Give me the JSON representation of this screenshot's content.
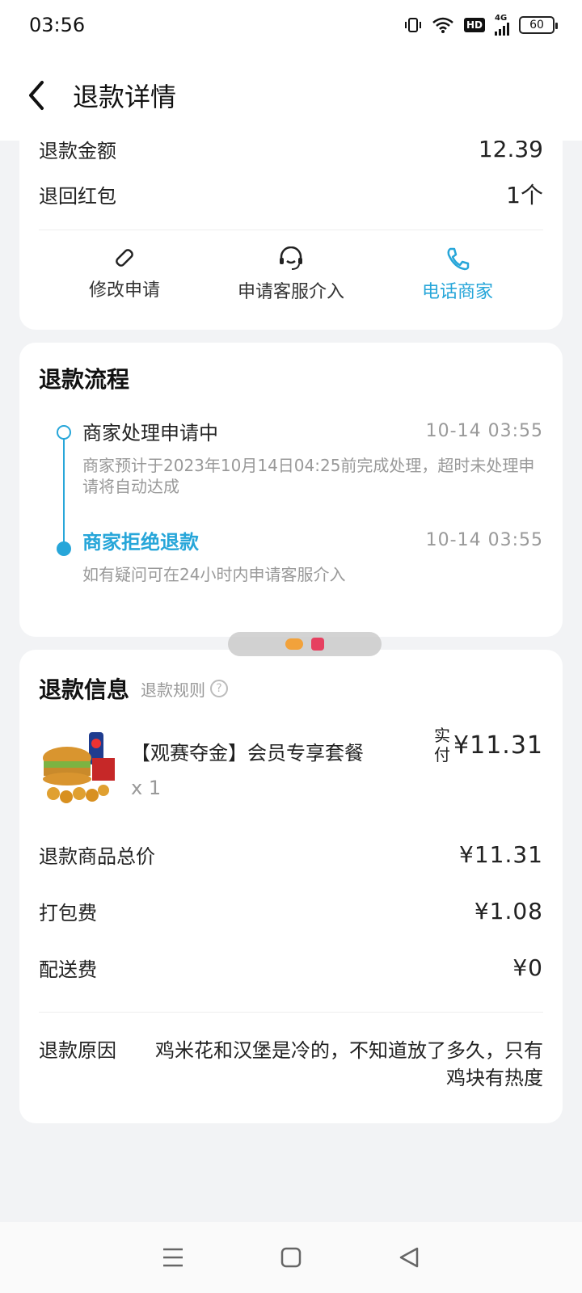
{
  "status_bar": {
    "time": "03:56",
    "network": "4G",
    "battery": "60",
    "hd_label": "HD"
  },
  "header": {
    "title": "退款详情"
  },
  "summary": {
    "partial_label": "退款金额",
    "partial_value": "12.39",
    "hongbao_label": "退回红包",
    "hongbao_value": "1个"
  },
  "actions": [
    {
      "label": "修改申请",
      "icon": "pencil-icon"
    },
    {
      "label": "申请客服介入",
      "icon": "headset-icon"
    },
    {
      "label": "电话商家",
      "icon": "phone-icon"
    }
  ],
  "process": {
    "title": "退款流程",
    "steps": [
      {
        "title": "商家处理申请中",
        "time": "10-14  03:55",
        "desc": "商家预计于2023年10月14日04:25前完成处理，超时未处理申请将自动达成"
      },
      {
        "title": "商家拒绝退款",
        "time": "10-14  03:55",
        "desc": "如有疑问可在24小时内申请客服介入"
      }
    ]
  },
  "refund_info": {
    "title": "退款信息",
    "rule_link": "退款规则",
    "product": {
      "name": "【观赛夺金】会员专享套餐",
      "qty": "x  1",
      "paid_label": "实付",
      "paid_value": "¥11.31"
    },
    "fees": [
      {
        "label": "退款商品总价",
        "value": "¥11.31"
      },
      {
        "label": "打包费",
        "value": "¥1.08"
      },
      {
        "label": "配送费",
        "value": "¥0"
      }
    ],
    "reason_label": "退款原因",
    "reason_text": "鸡米花和汉堡是冷的，不知道放了多久，只有鸡块有热度"
  },
  "colors": {
    "accent": "#27a6d9",
    "background": "#f2f3f5"
  }
}
